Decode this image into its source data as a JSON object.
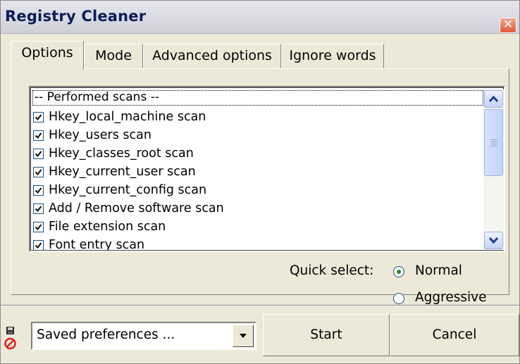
{
  "window": {
    "title": "Registry Cleaner",
    "close_symbol": "✕"
  },
  "tabs": [
    {
      "label": "Options",
      "active": true
    },
    {
      "label": "Mode",
      "active": false
    },
    {
      "label": "Advanced options",
      "active": false
    },
    {
      "label": "Ignore words",
      "active": false
    }
  ],
  "scan_list": {
    "header": "-- Performed scans --",
    "items": [
      {
        "label": "Hkey_local_machine scan",
        "checked": true
      },
      {
        "label": "Hkey_users scan",
        "checked": true
      },
      {
        "label": "Hkey_classes_root scan",
        "checked": true
      },
      {
        "label": "Hkey_current_user scan",
        "checked": true
      },
      {
        "label": "Hkey_current_config scan",
        "checked": true
      },
      {
        "label": "Add / Remove software scan",
        "checked": true
      },
      {
        "label": "File extension scan",
        "checked": true
      },
      {
        "label": "Font entry scan",
        "checked": true
      }
    ]
  },
  "quick_select": {
    "label": "Quick select:",
    "options": [
      {
        "label": "Normal",
        "selected": true
      },
      {
        "label": "Aggressive",
        "selected": false
      }
    ]
  },
  "footer": {
    "preferences_value": "Saved preferences ...",
    "start_label": "Start",
    "cancel_label": "Cancel"
  },
  "colors": {
    "title_text": "#0b1d55",
    "close_button": "#de5b3a",
    "radio_dot": "#2c8a2c",
    "check_mark": "#1a1a1a"
  }
}
